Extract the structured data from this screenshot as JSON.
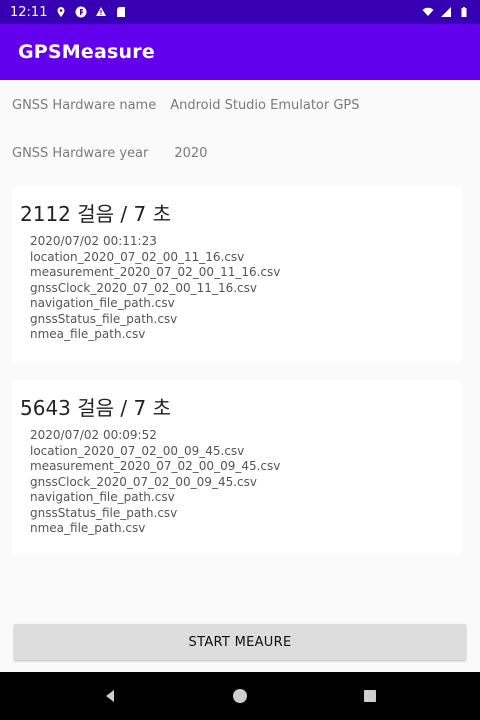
{
  "status_bar": {
    "time": "12:11",
    "icons": [
      "location-icon",
      "f-badge-icon",
      "alert-icon",
      "sd-card-icon",
      "wifi-icon",
      "cell-signal-icon",
      "battery-icon"
    ]
  },
  "app_bar": {
    "title": "GPSMeasure"
  },
  "hardware": {
    "name_label": "GNSS Hardware name",
    "name_value": "Android Studio Emulator GPS",
    "year_label": "GNSS Hardware year",
    "year_value": "2020"
  },
  "records": [
    {
      "title": "2112 걸음 / 7 초",
      "lines": [
        "2020/07/02 00:11:23",
        "location_2020_07_02_00_11_16.csv",
        "measurement_2020_07_02_00_11_16.csv",
        "gnssClock_2020_07_02_00_11_16.csv",
        "navigation_file_path.csv",
        "gnssStatus_file_path.csv",
        "nmea_file_path.csv"
      ]
    },
    {
      "title": "5643 걸음 / 7 초",
      "lines": [
        "2020/07/02 00:09:52",
        "location_2020_07_02_00_09_45.csv",
        "measurement_2020_07_02_00_09_45.csv",
        "gnssClock_2020_07_02_00_09_45.csv",
        "navigation_file_path.csv",
        "gnssStatus_file_path.csv",
        "nmea_file_path.csv"
      ]
    }
  ],
  "actions": {
    "start_label": "START MEAURE"
  },
  "nav_bar": {
    "icons": [
      "back-icon",
      "home-icon",
      "recents-icon"
    ]
  },
  "colors": {
    "status_bar": "#3700b3",
    "app_bar": "#6200ee",
    "button": "#dddddd"
  }
}
